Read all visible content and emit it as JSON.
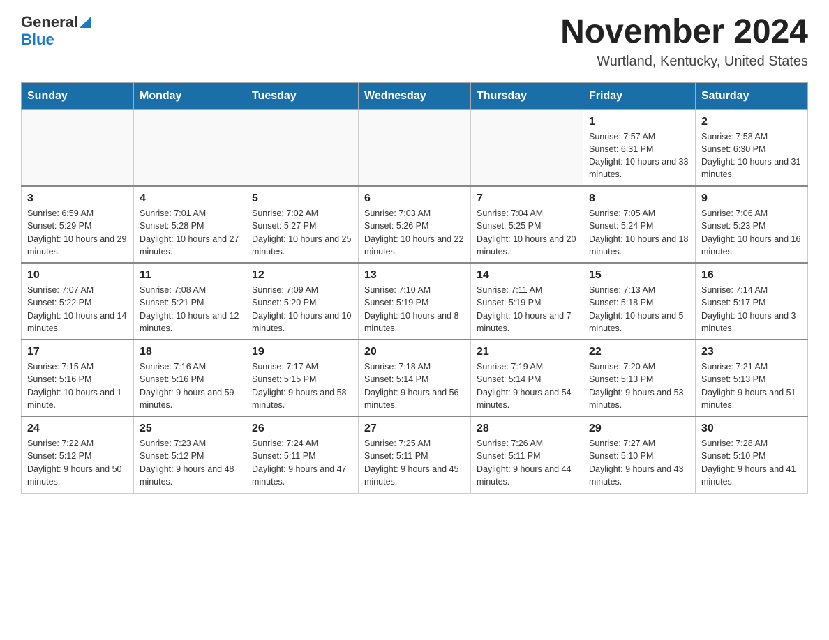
{
  "header": {
    "logo_general": "General",
    "logo_blue": "Blue",
    "title": "November 2024",
    "subtitle": "Wurtland, Kentucky, United States"
  },
  "days_of_week": [
    "Sunday",
    "Monday",
    "Tuesday",
    "Wednesday",
    "Thursday",
    "Friday",
    "Saturday"
  ],
  "weeks": [
    [
      {
        "day": "",
        "info": ""
      },
      {
        "day": "",
        "info": ""
      },
      {
        "day": "",
        "info": ""
      },
      {
        "day": "",
        "info": ""
      },
      {
        "day": "",
        "info": ""
      },
      {
        "day": "1",
        "info": "Sunrise: 7:57 AM\nSunset: 6:31 PM\nDaylight: 10 hours and 33 minutes."
      },
      {
        "day": "2",
        "info": "Sunrise: 7:58 AM\nSunset: 6:30 PM\nDaylight: 10 hours and 31 minutes."
      }
    ],
    [
      {
        "day": "3",
        "info": "Sunrise: 6:59 AM\nSunset: 5:29 PM\nDaylight: 10 hours and 29 minutes."
      },
      {
        "day": "4",
        "info": "Sunrise: 7:01 AM\nSunset: 5:28 PM\nDaylight: 10 hours and 27 minutes."
      },
      {
        "day": "5",
        "info": "Sunrise: 7:02 AM\nSunset: 5:27 PM\nDaylight: 10 hours and 25 minutes."
      },
      {
        "day": "6",
        "info": "Sunrise: 7:03 AM\nSunset: 5:26 PM\nDaylight: 10 hours and 22 minutes."
      },
      {
        "day": "7",
        "info": "Sunrise: 7:04 AM\nSunset: 5:25 PM\nDaylight: 10 hours and 20 minutes."
      },
      {
        "day": "8",
        "info": "Sunrise: 7:05 AM\nSunset: 5:24 PM\nDaylight: 10 hours and 18 minutes."
      },
      {
        "day": "9",
        "info": "Sunrise: 7:06 AM\nSunset: 5:23 PM\nDaylight: 10 hours and 16 minutes."
      }
    ],
    [
      {
        "day": "10",
        "info": "Sunrise: 7:07 AM\nSunset: 5:22 PM\nDaylight: 10 hours and 14 minutes."
      },
      {
        "day": "11",
        "info": "Sunrise: 7:08 AM\nSunset: 5:21 PM\nDaylight: 10 hours and 12 minutes."
      },
      {
        "day": "12",
        "info": "Sunrise: 7:09 AM\nSunset: 5:20 PM\nDaylight: 10 hours and 10 minutes."
      },
      {
        "day": "13",
        "info": "Sunrise: 7:10 AM\nSunset: 5:19 PM\nDaylight: 10 hours and 8 minutes."
      },
      {
        "day": "14",
        "info": "Sunrise: 7:11 AM\nSunset: 5:19 PM\nDaylight: 10 hours and 7 minutes."
      },
      {
        "day": "15",
        "info": "Sunrise: 7:13 AM\nSunset: 5:18 PM\nDaylight: 10 hours and 5 minutes."
      },
      {
        "day": "16",
        "info": "Sunrise: 7:14 AM\nSunset: 5:17 PM\nDaylight: 10 hours and 3 minutes."
      }
    ],
    [
      {
        "day": "17",
        "info": "Sunrise: 7:15 AM\nSunset: 5:16 PM\nDaylight: 10 hours and 1 minute."
      },
      {
        "day": "18",
        "info": "Sunrise: 7:16 AM\nSunset: 5:16 PM\nDaylight: 9 hours and 59 minutes."
      },
      {
        "day": "19",
        "info": "Sunrise: 7:17 AM\nSunset: 5:15 PM\nDaylight: 9 hours and 58 minutes."
      },
      {
        "day": "20",
        "info": "Sunrise: 7:18 AM\nSunset: 5:14 PM\nDaylight: 9 hours and 56 minutes."
      },
      {
        "day": "21",
        "info": "Sunrise: 7:19 AM\nSunset: 5:14 PM\nDaylight: 9 hours and 54 minutes."
      },
      {
        "day": "22",
        "info": "Sunrise: 7:20 AM\nSunset: 5:13 PM\nDaylight: 9 hours and 53 minutes."
      },
      {
        "day": "23",
        "info": "Sunrise: 7:21 AM\nSunset: 5:13 PM\nDaylight: 9 hours and 51 minutes."
      }
    ],
    [
      {
        "day": "24",
        "info": "Sunrise: 7:22 AM\nSunset: 5:12 PM\nDaylight: 9 hours and 50 minutes."
      },
      {
        "day": "25",
        "info": "Sunrise: 7:23 AM\nSunset: 5:12 PM\nDaylight: 9 hours and 48 minutes."
      },
      {
        "day": "26",
        "info": "Sunrise: 7:24 AM\nSunset: 5:11 PM\nDaylight: 9 hours and 47 minutes."
      },
      {
        "day": "27",
        "info": "Sunrise: 7:25 AM\nSunset: 5:11 PM\nDaylight: 9 hours and 45 minutes."
      },
      {
        "day": "28",
        "info": "Sunrise: 7:26 AM\nSunset: 5:11 PM\nDaylight: 9 hours and 44 minutes."
      },
      {
        "day": "29",
        "info": "Sunrise: 7:27 AM\nSunset: 5:10 PM\nDaylight: 9 hours and 43 minutes."
      },
      {
        "day": "30",
        "info": "Sunrise: 7:28 AM\nSunset: 5:10 PM\nDaylight: 9 hours and 41 minutes."
      }
    ]
  ]
}
